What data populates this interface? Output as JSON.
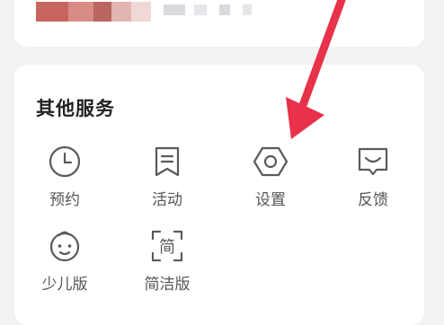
{
  "section": {
    "title": "其他服务"
  },
  "services": [
    {
      "label": "预约",
      "icon": "clock-icon"
    },
    {
      "label": "活动",
      "icon": "bookmark-note-icon"
    },
    {
      "label": "设置",
      "icon": "hexagon-gear-icon"
    },
    {
      "label": "反馈",
      "icon": "feedback-chat-icon"
    },
    {
      "label": "少儿版",
      "icon": "child-face-icon"
    },
    {
      "label": "简洁版",
      "icon": "simple-mode-icon",
      "icon_char": "简"
    }
  ],
  "colors": {
    "annotation_arrow": "#e8324a",
    "icon_stroke": "#5a5a5a",
    "card_bg": "#ffffff",
    "page_bg": "#f2f2f4"
  }
}
